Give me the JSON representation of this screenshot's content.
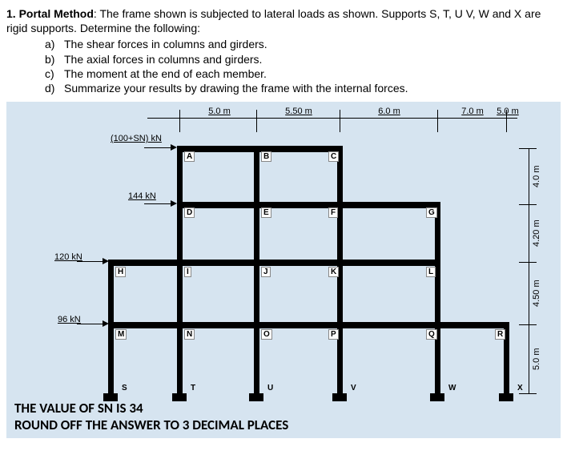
{
  "problem": {
    "number": "1.",
    "title_bold": "Portal Method",
    "title_rest": ": The frame shown is subjected to lateral loads as shown. Supports S, T, U V, W and X are rigid supports. Determine the following:",
    "items": {
      "a": {
        "label": "a)",
        "text": "The shear forces in columns and girders."
      },
      "b": {
        "label": "b)",
        "text": "The axial forces in columns and girders."
      },
      "c": {
        "label": "c)",
        "text": "The moment at the end of each member."
      },
      "d": {
        "label": "d)",
        "text": "Summarize your results by drawing the frame with the internal forces."
      }
    }
  },
  "dimensions": {
    "top": {
      "d1": "5.0 m",
      "d2": "5.50 m",
      "d3": "6.0 m",
      "d4": "7.0 m",
      "d5": "5.0 m"
    },
    "right": {
      "h1": "4.0 m",
      "h2": "4.20 m",
      "h3": "4.50 m",
      "h4": "5.0 m"
    }
  },
  "loads": {
    "l1": "(100+SN) kN",
    "l2": "144 kN",
    "l3": "120 kN",
    "l4": "96 kN"
  },
  "nodes": {
    "A": "A",
    "B": "B",
    "C": "C",
    "D": "D",
    "E": "E",
    "F": "F",
    "G": "G",
    "H": "H",
    "I": "I",
    "J": "J",
    "K": "K",
    "L": "L",
    "M": "M",
    "N": "N",
    "O": "O",
    "P": "P",
    "Q": "Q",
    "R": "R",
    "S": "S",
    "T": "T",
    "U": "U",
    "V": "V",
    "W": "W",
    "X": "X"
  },
  "notes": {
    "sn": "THE VALUE OF SN IS 34",
    "round": "ROUND OFF THE ANSWER TO 3 DECIMAL PLACES"
  }
}
